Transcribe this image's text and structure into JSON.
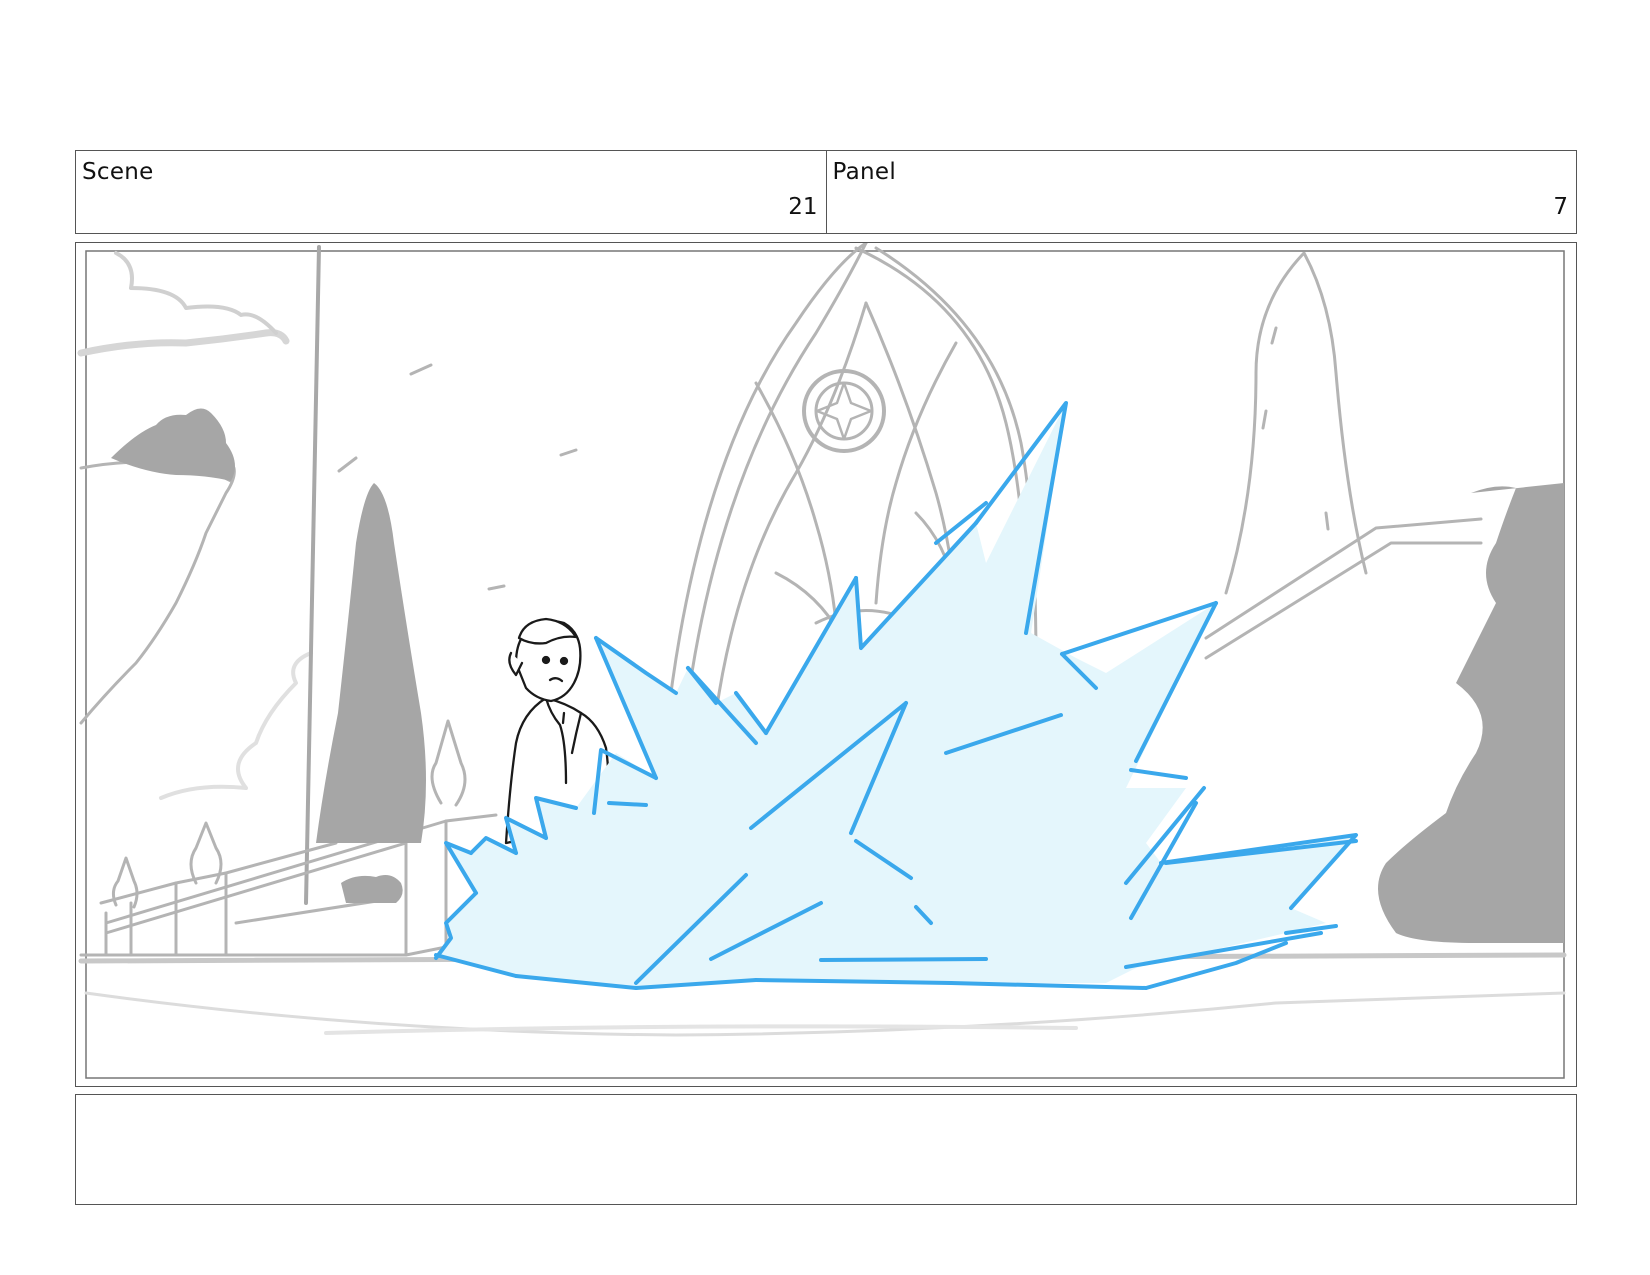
{
  "header": {
    "scene_label": "Scene",
    "scene_number": "21",
    "panel_label": "Panel",
    "panel_number": "7"
  },
  "panel_image": {
    "description_icon": "storyboard-sketch-ice-burst",
    "colors": {
      "ice_stroke": "#3aa8ec",
      "ice_fill": "#e4f6fc",
      "sketch": "#b4b4b4",
      "dark_sketch": "#a6a6a6",
      "ink": "#1a1a1a"
    }
  },
  "notes": {
    "text": ""
  }
}
